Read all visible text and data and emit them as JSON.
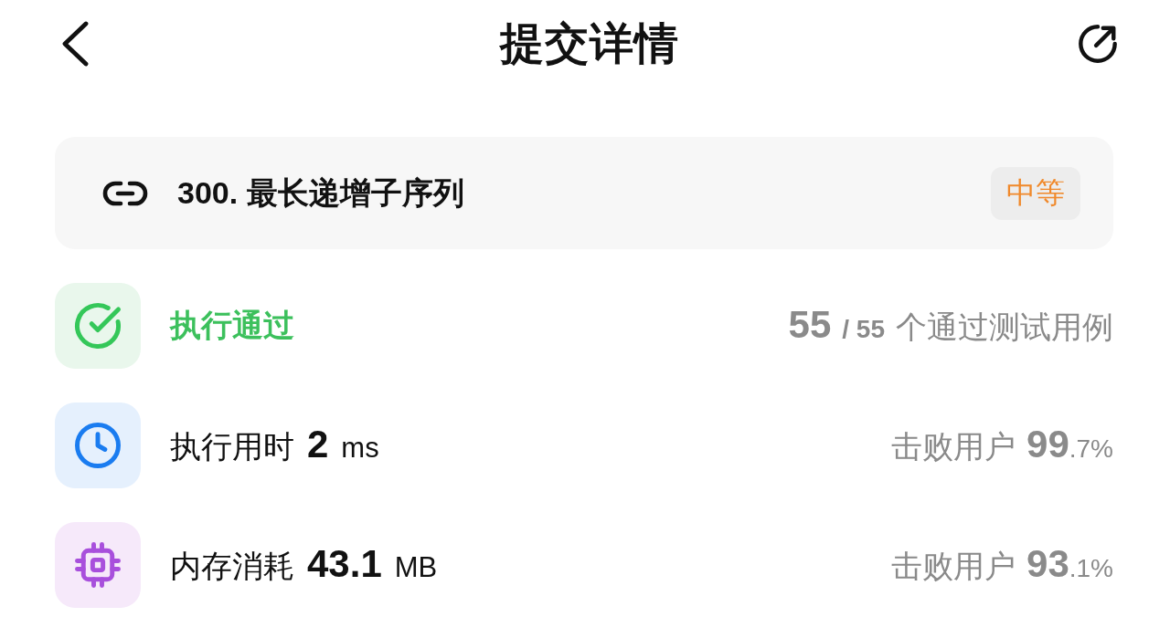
{
  "header": {
    "title": "提交详情"
  },
  "problem": {
    "title": "300. 最长递增子序列",
    "difficulty": {
      "label": "中等",
      "kind": "medium"
    }
  },
  "results": [
    {
      "kind": "status",
      "label": "执行通过",
      "passed": "55",
      "total": "/ 55",
      "caption": "个通过测试用例"
    },
    {
      "kind": "runtime",
      "label": "执行用时",
      "value": "2",
      "unit": "ms",
      "beat_label": "击败用户",
      "beat_whole": "99",
      "beat_fraction": ".7%"
    },
    {
      "kind": "memory",
      "label": "内存消耗",
      "value": "43.1",
      "unit": "MB",
      "beat_label": "击败用户",
      "beat_whole": "93",
      "beat_fraction": ".1%"
    }
  ]
}
